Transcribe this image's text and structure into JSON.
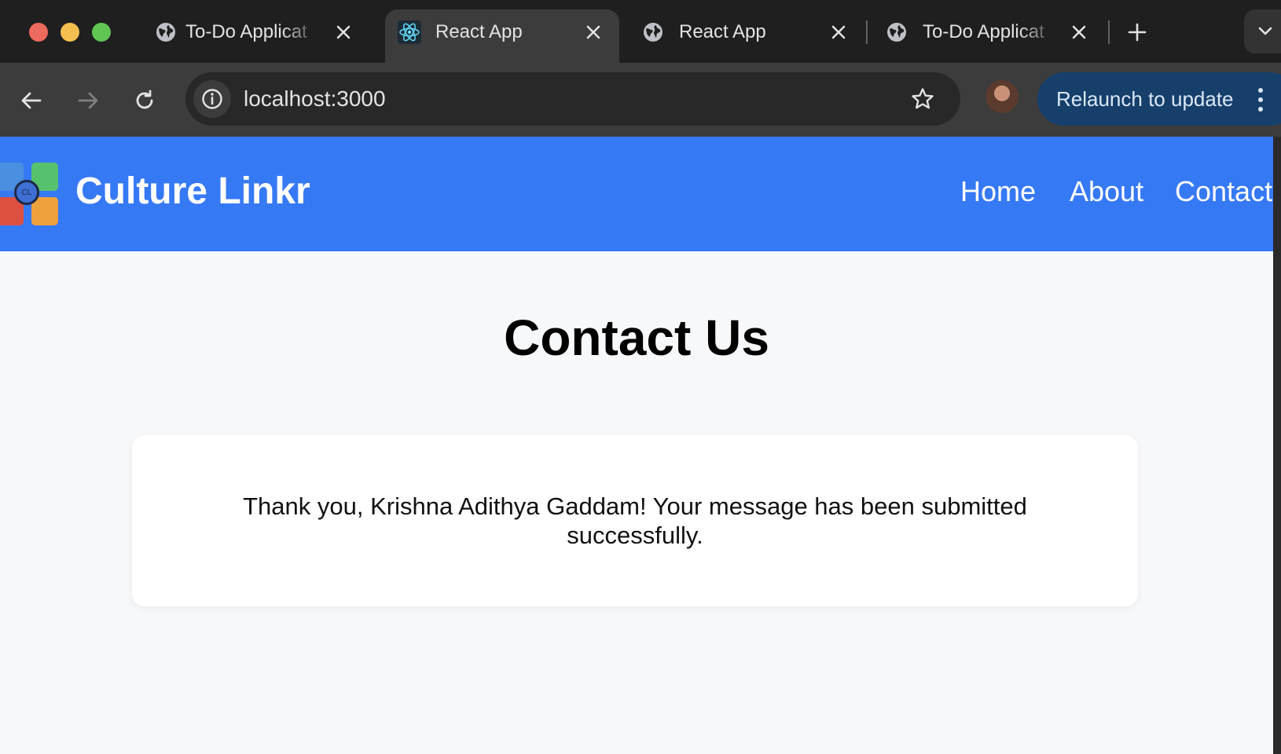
{
  "browser": {
    "tabs": [
      {
        "title": "To-Do Applicat",
        "favicon": "globe-icon",
        "active": false
      },
      {
        "title": "React App",
        "favicon": "react-icon",
        "active": true
      },
      {
        "title": "React App",
        "favicon": "globe-icon",
        "active": false
      },
      {
        "title": "To-Do Applicat",
        "favicon": "globe-icon",
        "active": false
      }
    ],
    "url": "localhost:3000",
    "relaunch_label": "Relaunch to update",
    "colors": {
      "tabstrip": "#1f1f1f",
      "toolbar": "#3c3c3c",
      "omnibox": "#282828",
      "relaunch": "#16406b"
    }
  },
  "site": {
    "brand": "Culture Linkr",
    "logo_badge": "CL",
    "nav": [
      "Home",
      "About",
      "Contact"
    ],
    "header_color": "#3679f5"
  },
  "main": {
    "title": "Contact Us",
    "message": "Thank you, Krishna Adithya Gaddam! Your message has been submitted successfully."
  }
}
